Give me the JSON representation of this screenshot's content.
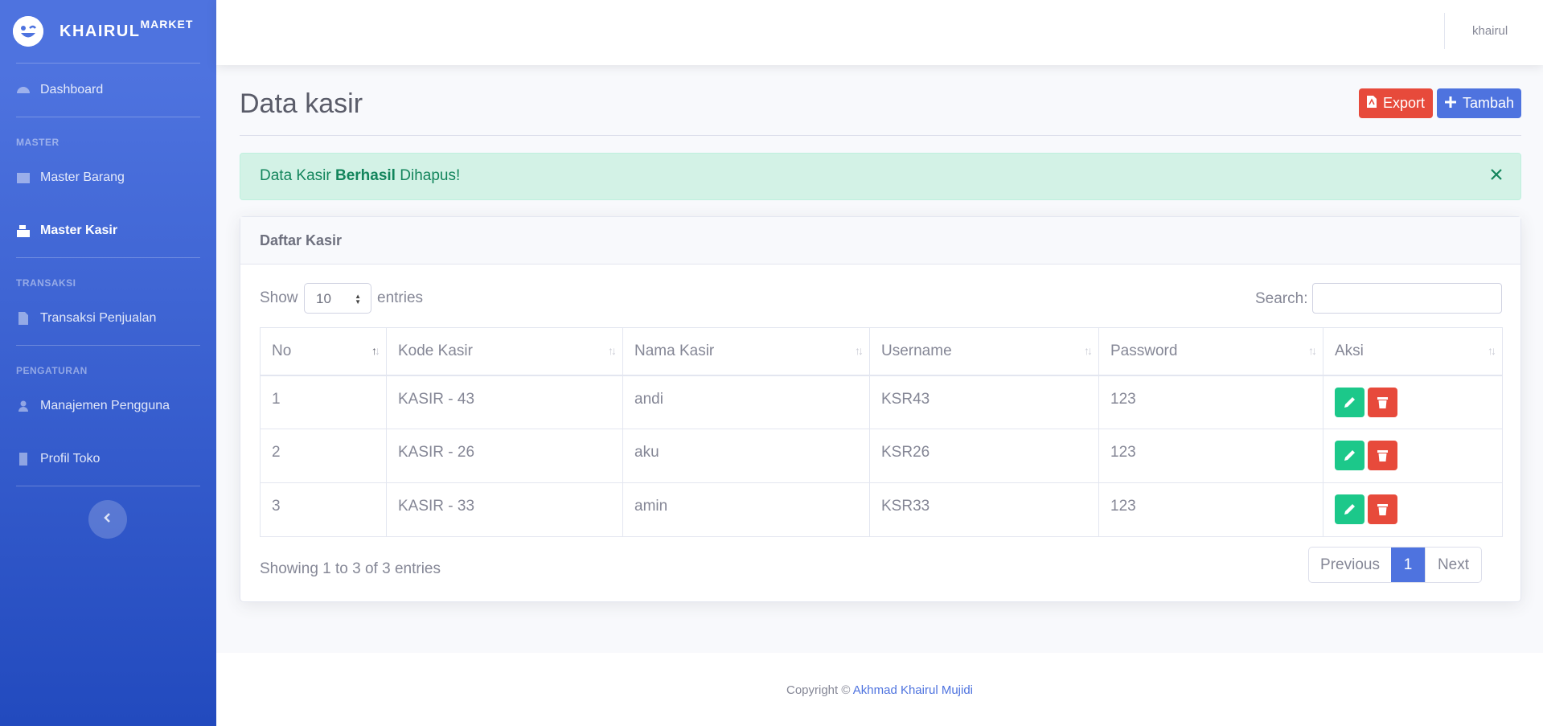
{
  "brand": {
    "name": "KHAIRUL",
    "sup": "MARKET"
  },
  "sidebar": {
    "dashboard": "Dashboard",
    "heading_master": "MASTER",
    "master_barang": "Master Barang",
    "master_kasir": "Master Kasir",
    "heading_transaksi": "TRANSAKSI",
    "transaksi_penjualan": "Transaksi Penjualan",
    "heading_pengaturan": "PENGATURAN",
    "manajemen_pengguna": "Manajemen Pengguna",
    "profil_toko": "Profil Toko"
  },
  "topbar": {
    "user": "khairul"
  },
  "page": {
    "title": "Data kasir",
    "export_label": "Export",
    "tambah_label": "Tambah"
  },
  "alert": {
    "prefix": "Data Kasir",
    "bold": "Berhasil",
    "suffix": "Dihapus!",
    "close": "×"
  },
  "card": {
    "title": "Daftar Kasir"
  },
  "table_controls": {
    "show_label": "Show",
    "show_value": "10",
    "entries_label": "entries",
    "search_label": "Search:"
  },
  "table": {
    "headers": [
      "No",
      "Kode Kasir",
      "Nama Kasir",
      "Username",
      "Password",
      "Aksi"
    ],
    "rows": [
      [
        "1",
        "KASIR - 43",
        "andi",
        "KSR43",
        "123"
      ],
      [
        "2",
        "KASIR - 26",
        "aku",
        "KSR26",
        "123"
      ],
      [
        "3",
        "KASIR - 33",
        "amin",
        "KSR33",
        "123"
      ]
    ]
  },
  "footer_info": "Showing 1 to 3 of 3 entries",
  "pagination": {
    "previous": "Previous",
    "current": "1",
    "next": "Next"
  },
  "footer": {
    "copyright": "Copyright ©",
    "author": "Akhmad Khairul Mujidi"
  },
  "colors": {
    "primary": "#4e73df",
    "danger": "#e74a3b",
    "success": "#1cc88a"
  },
  "icons": [
    "laugh-wink-icon",
    "dashboard-icon",
    "box-icon",
    "cash-register-icon",
    "file-icon",
    "users-icon",
    "building-icon",
    "chevron-left-icon",
    "file-pdf-icon",
    "plus-icon",
    "close-icon",
    "sort-icon",
    "pencil-icon",
    "trash-icon"
  ]
}
